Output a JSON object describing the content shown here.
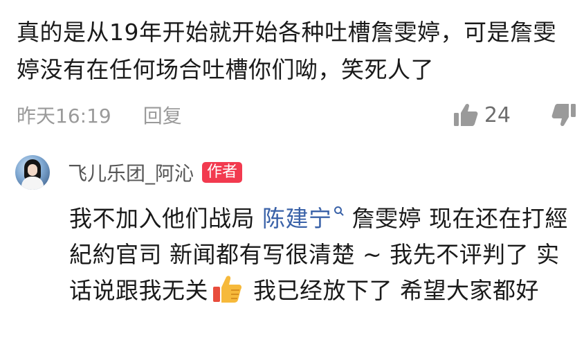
{
  "comment": {
    "text": "真的是从19年开始就开始各种吐槽詹雯婷，可是詹雯婷没有在任何场合吐槽你们呦，笑死人了",
    "time": "昨天16:19",
    "reply_label": "回复",
    "like_count": "24",
    "icons": {
      "like": "thumbs-up-icon",
      "dislike": "thumbs-down-icon"
    }
  },
  "reply": {
    "username": "飞儿乐团_阿沁",
    "badge": "作者",
    "badge_color": "#f23a4f",
    "text_1": "我不加入他们战局 ",
    "mention": "陈建宁",
    "text_2": " 詹雯婷 现在还在打經紀約官司 新闻都有写很清楚 ~ 我先不评判了 实话说跟我无关",
    "text_3": " 我已经放下了 希望大家都好",
    "icons": {
      "avatar": "avatar-image",
      "mention_search": "search-icon",
      "emoji": "thumbs-up-emoji-icon"
    }
  },
  "colors": {
    "mention": "#3a62a8",
    "meta": "#9a9a9a",
    "text": "#1a1a1a"
  }
}
